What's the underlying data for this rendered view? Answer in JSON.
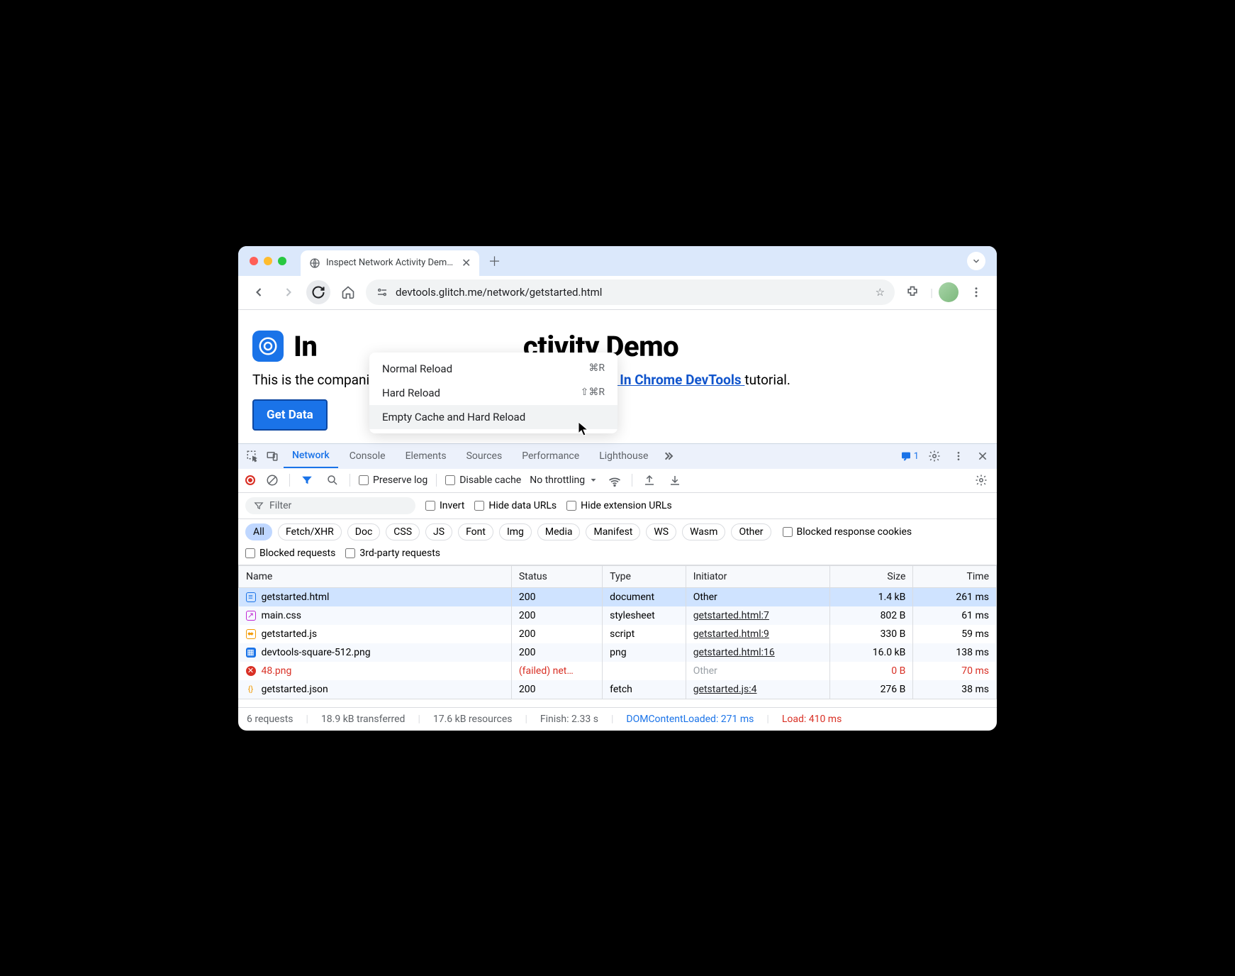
{
  "browser": {
    "tab_title": "Inspect Network Activity Dem…",
    "url": "devtools.glitch.me/network/getstarted.html"
  },
  "context_menu": {
    "items": [
      {
        "label": "Normal Reload",
        "shortcut": "⌘R"
      },
      {
        "label": "Hard Reload",
        "shortcut": "⇧⌘R"
      },
      {
        "label": "Empty Cache and Hard Reload",
        "shortcut": ""
      }
    ]
  },
  "page": {
    "heading": "Inspect Network Activity Demo",
    "heading_visible_prefix": "In",
    "heading_visible_suffix": "ctivity Demo",
    "description_prefix": "This is the companion demo for the ",
    "link_text": "Inspect Network Activity In Chrome DevTools ",
    "description_suffix": "tutorial.",
    "button": "Get Data"
  },
  "devtools": {
    "tabs": [
      "Network",
      "Console",
      "Elements",
      "Sources",
      "Performance",
      "Lighthouse"
    ],
    "active_tab": "Network",
    "message_count": "1",
    "toolbar": {
      "preserve_log": "Preserve log",
      "disable_cache": "Disable cache",
      "throttling": "No throttling"
    },
    "filter": {
      "placeholder": "Filter",
      "invert": "Invert",
      "hide_data_urls": "Hide data URLs",
      "hide_ext_urls": "Hide extension URLs"
    },
    "types": [
      "All",
      "Fetch/XHR",
      "Doc",
      "CSS",
      "JS",
      "Font",
      "Img",
      "Media",
      "Manifest",
      "WS",
      "Wasm",
      "Other"
    ],
    "blocked_response": "Blocked response cookies",
    "blocked_requests": "Blocked requests",
    "third_party": "3rd-party requests",
    "columns": {
      "name": "Name",
      "status": "Status",
      "type": "Type",
      "initiator": "Initiator",
      "size": "Size",
      "time": "Time"
    },
    "rows": [
      {
        "name": "getstarted.html",
        "status": "200",
        "type": "document",
        "initiator": "Other",
        "initiator_link": false,
        "size": "1.4 kB",
        "time": "261 ms",
        "icon": "doc",
        "selected": true
      },
      {
        "name": "main.css",
        "status": "200",
        "type": "stylesheet",
        "initiator": "getstarted.html:7",
        "initiator_link": true,
        "size": "802 B",
        "time": "61 ms",
        "icon": "css"
      },
      {
        "name": "getstarted.js",
        "status": "200",
        "type": "script",
        "initiator": "getstarted.html:9",
        "initiator_link": true,
        "size": "330 B",
        "time": "59 ms",
        "icon": "js"
      },
      {
        "name": "devtools-square-512.png",
        "status": "200",
        "type": "png",
        "initiator": "getstarted.html:16",
        "initiator_link": true,
        "size": "16.0 kB",
        "time": "138 ms",
        "icon": "img"
      },
      {
        "name": "48.png",
        "status": "(failed) net…",
        "type": "",
        "initiator": "Other",
        "initiator_link": false,
        "size": "0 B",
        "time": "70 ms",
        "icon": "err",
        "failed": true
      },
      {
        "name": "getstarted.json",
        "status": "200",
        "type": "fetch",
        "initiator": "getstarted.js:4",
        "initiator_link": true,
        "size": "276 B",
        "time": "38 ms",
        "icon": "json"
      }
    ],
    "status": {
      "requests": "6 requests",
      "transferred": "18.9 kB transferred",
      "resources": "17.6 kB resources",
      "finish": "Finish: 2.33 s",
      "dcl": "DOMContentLoaded: 271 ms",
      "load": "Load: 410 ms"
    }
  }
}
